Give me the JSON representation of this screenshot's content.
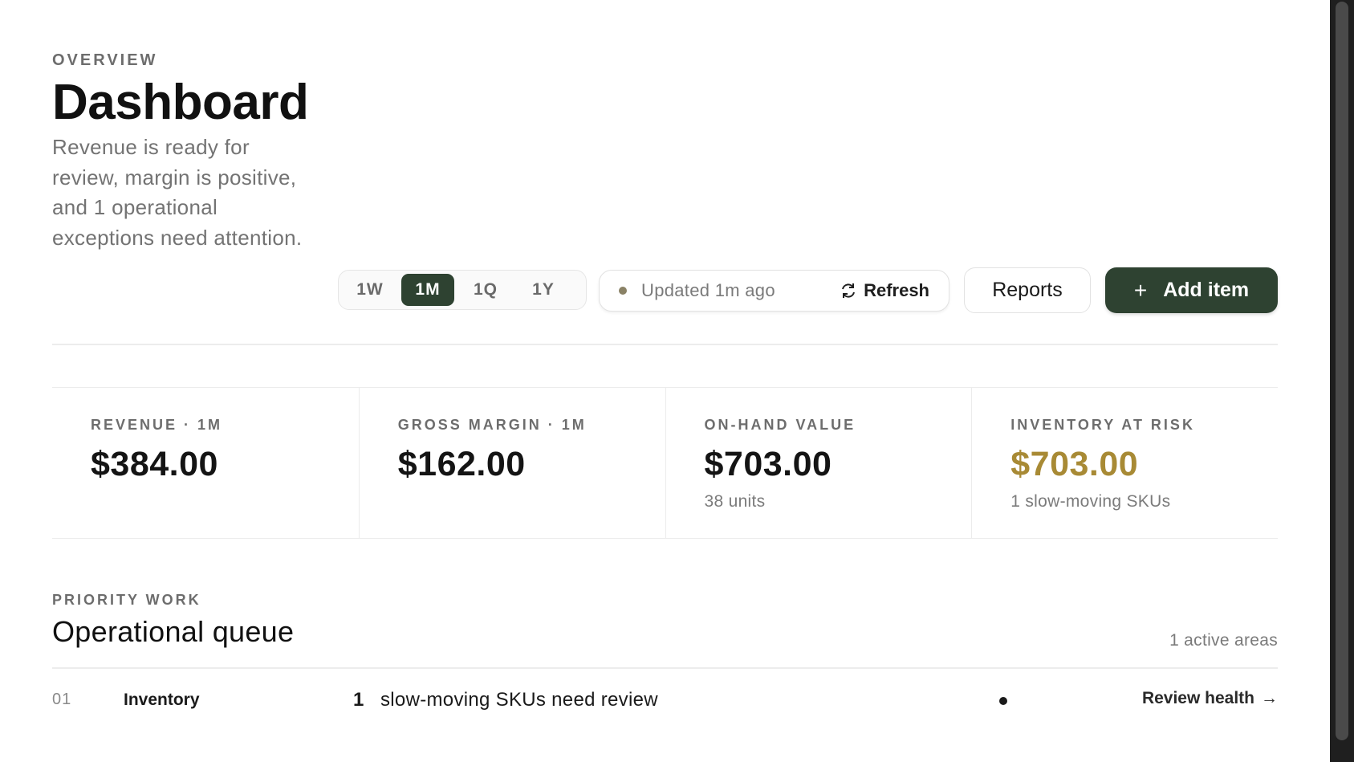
{
  "header": {
    "eyebrow": "OVERVIEW",
    "title": "Dashboard",
    "subtitle": "Revenue is ready for review, margin is positive, and 1 operational exceptions need attention."
  },
  "controls": {
    "periods": [
      {
        "label": "1W",
        "active": false
      },
      {
        "label": "1M",
        "active": true
      },
      {
        "label": "1Q",
        "active": false
      },
      {
        "label": "1Y",
        "active": false
      }
    ],
    "status_text": "Updated 1m ago",
    "refresh_label": "Refresh",
    "reports_label": "Reports",
    "add_label": "Add item",
    "accent_color": "#2e4231"
  },
  "metrics": [
    {
      "label": "REVENUE · 1M",
      "value": "$384.00",
      "note": ""
    },
    {
      "label": "GROSS MARGIN · 1M",
      "value": "$162.00",
      "note": ""
    },
    {
      "label": "ON-HAND VALUE",
      "value": "$703.00",
      "note": "38 units"
    },
    {
      "label": "INVENTORY AT RISK",
      "value": "$703.00",
      "note": "1 slow-moving SKUs",
      "color": "#a88a35"
    }
  ],
  "queue": {
    "eyebrow": "PRIORITY WORK",
    "title": "Operational queue",
    "count_text": "1 active areas",
    "rows": [
      {
        "index": "01",
        "area": "Inventory",
        "count": "1",
        "message": "slow-moving SKUs need review",
        "action": "Review health"
      }
    ]
  }
}
